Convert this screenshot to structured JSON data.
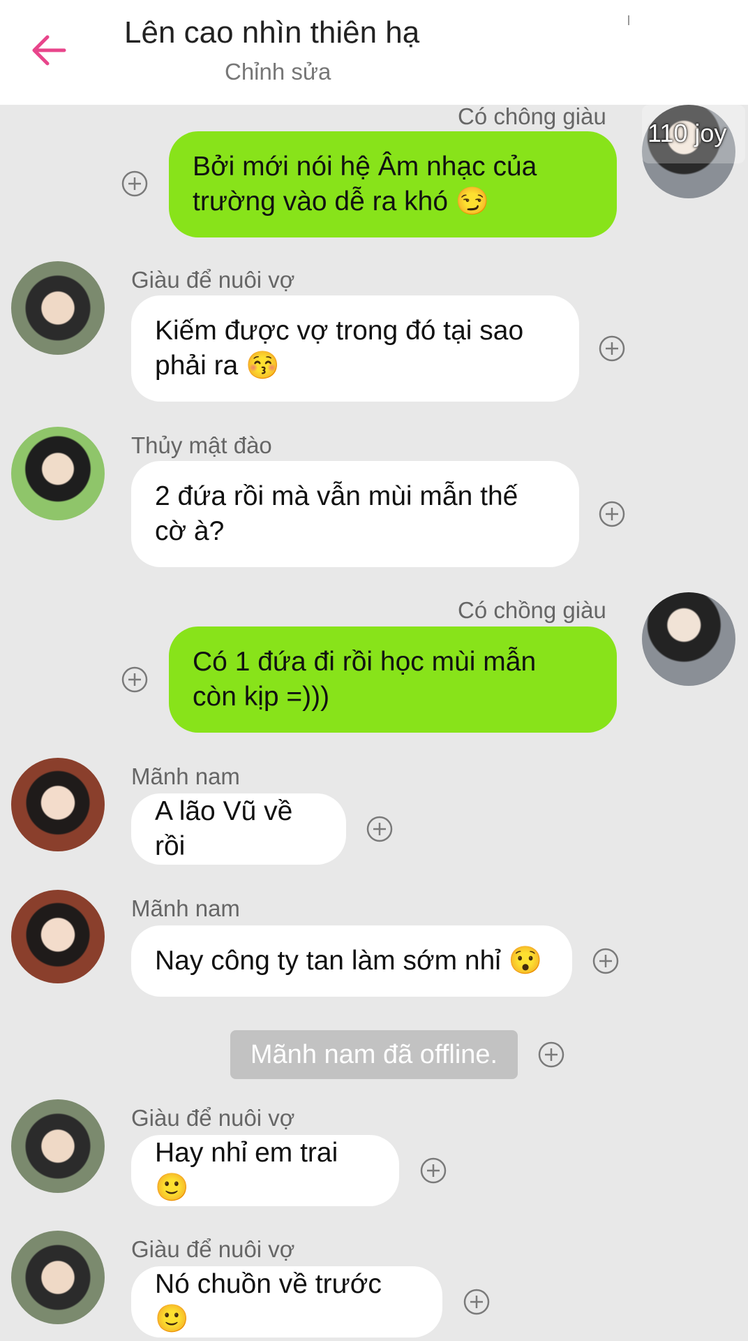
{
  "header": {
    "title": "Lên cao nhìn thiên hạ",
    "subtitle": "Chỉnh sửa",
    "accent_color": "#e8458b"
  },
  "overlay_text": "110 joy",
  "messages": [
    {
      "sender": "Có chông giàu",
      "text": "Bởi mới nói hệ Âm nhạc của\ntrường vào dễ ra khó 😏",
      "direction": "outgoing"
    },
    {
      "sender": "Giàu để nuôi vợ",
      "text": "Kiếm được vợ trong đó tại sao\nphải ra 😚",
      "direction": "incoming"
    },
    {
      "sender": "Thủy mật đào",
      "text": "2 đứa rồi mà vẫn mùi mẫn thế\ncờ à?",
      "direction": "incoming"
    },
    {
      "sender": "Có chồng giàu",
      "text": "Có 1 đứa đi rồi học mùi mẫn\ncòn kịp =)))",
      "direction": "outgoing"
    },
    {
      "sender": "Mãnh nam",
      "text": "A lão Vũ về rồi",
      "direction": "incoming"
    },
    {
      "sender": "Mãnh nam",
      "text": "Nay công ty tan làm sớm nhỉ 😯",
      "direction": "incoming"
    },
    {
      "sender": "Giàu để nuôi vợ",
      "text": "Hay nhỉ em trai 🙂",
      "direction": "incoming"
    },
    {
      "sender": "Giàu để nuôi vợ",
      "text": "Nó chuồn về trước 🙂",
      "direction": "incoming"
    }
  ],
  "system_message": "Mãnh nam đã offline.",
  "colors": {
    "outgoing_bubble": "#88e31a",
    "incoming_bubble": "#ffffff",
    "chat_background": "#e8e8e8"
  }
}
